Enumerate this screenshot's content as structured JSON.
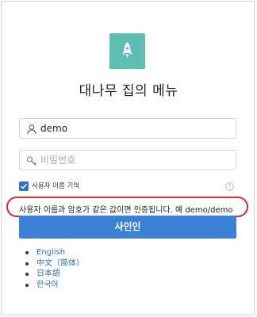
{
  "app": {
    "title": "대나무 집의 메뉴",
    "logo_icon": "rocket-icon",
    "brand_color": "#5cbfb1"
  },
  "login": {
    "username_value": "demo",
    "username_icon": "user-icon",
    "password_placeholder": "비밀번호",
    "password_icon": "key-icon",
    "remember_label": "사용자 이름 기억",
    "remember_checked": true,
    "help_icon": "question-icon",
    "hint": "사용자 이름과 암호가 같은 값이면 인증됩니다. 예 demo/demo",
    "submit_label": "사인인",
    "accent_color": "#3b82d6"
  },
  "languages": [
    {
      "label": "English"
    },
    {
      "label": "中文（简体）"
    },
    {
      "label": "日本語"
    },
    {
      "label": "한국어"
    }
  ]
}
